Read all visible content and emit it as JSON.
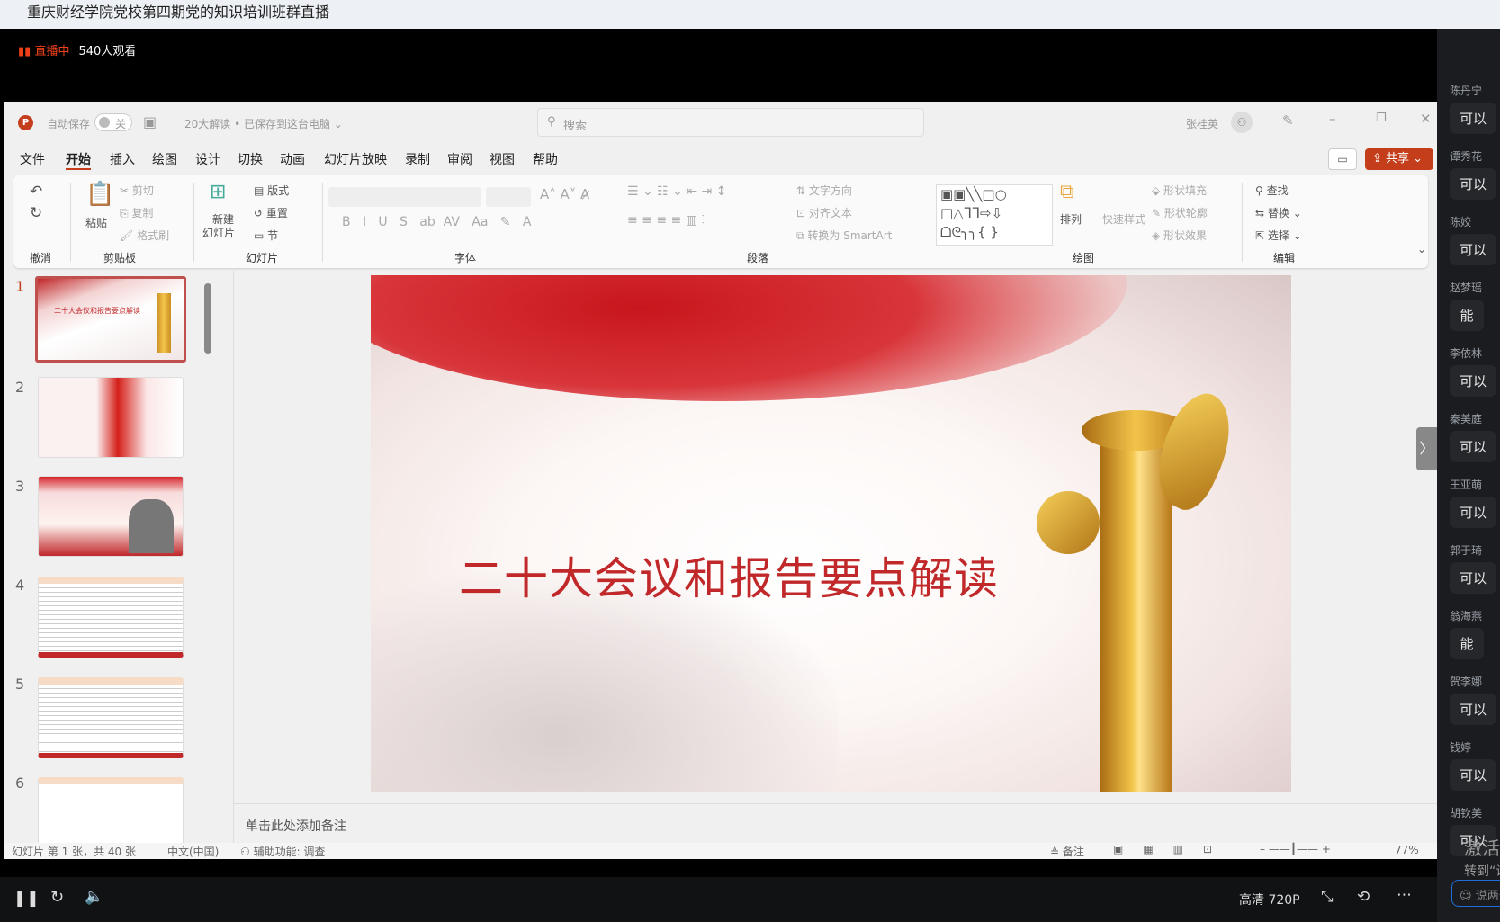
{
  "stream": {
    "title": "重庆财经学院党校第四期党的知识培训班群直播",
    "live_label": "直播中",
    "viewers": "540人观看",
    "quality": "高清 720P"
  },
  "ppt": {
    "autosave_label": "自动保存",
    "autosave_state": "关",
    "doc_title": "20大解读 • 已保存到这台电脑 ⌄",
    "search_placeholder": "搜索",
    "user": "张桂英",
    "menu": [
      "文件",
      "开始",
      "插入",
      "绘图",
      "设计",
      "切换",
      "动画",
      "幻灯片放映",
      "录制",
      "审阅",
      "视图",
      "帮助"
    ],
    "active_menu": "开始",
    "share": "共享",
    "ribbon": {
      "undo_group": "撤消",
      "paste": "粘贴",
      "cut": "剪切",
      "copy": "复制",
      "format_painter": "格式刷",
      "clipboard_group": "剪贴板",
      "new_slide": "新建",
      "new_slide2": "幻灯片",
      "layout": "版式",
      "reset": "重置",
      "section": "节",
      "slides_group": "幻灯片",
      "font_group": "字体",
      "text_direction": "文字方向",
      "align_text": "对齐文本",
      "smartart": "转换为 SmartArt",
      "paragraph_group": "段落",
      "arrange": "排列",
      "quick_styles": "快速样式",
      "shape_fill": "形状填充",
      "shape_outline": "形状轮廓",
      "shape_effects": "形状效果",
      "drawing_group": "绘图",
      "find": "查找",
      "replace": "替换",
      "select": "选择",
      "editing_group": "编辑"
    },
    "slide_numbers": [
      "1",
      "2",
      "3",
      "4",
      "5",
      "6"
    ],
    "slide_title": "二十大会议和报告要点解读",
    "notes_placeholder": "单击此处添加备注",
    "status": {
      "slide_count": "幻灯片 第 1 张，共 40 张",
      "language": "中文(中国)",
      "accessibility": "辅助功能: 调查",
      "notes": "备注",
      "zoom": "77%"
    }
  },
  "comments": [
    {
      "name": "陈丹宁",
      "text": "可以"
    },
    {
      "name": "谭秀花",
      "text": "可以"
    },
    {
      "name": "陈姣",
      "text": "可以"
    },
    {
      "name": "赵梦瑶",
      "text": "能"
    },
    {
      "name": "李依林",
      "text": "可以"
    },
    {
      "name": "秦美庭",
      "text": "可以"
    },
    {
      "name": "王亚萌",
      "text": "可以"
    },
    {
      "name": "郭于琦",
      "text": "可以"
    },
    {
      "name": "翁海燕",
      "text": "能"
    },
    {
      "name": "贺李娜",
      "text": "可以"
    },
    {
      "name": "钱婷",
      "text": "可以"
    },
    {
      "name": "胡钦美",
      "text": "可以"
    }
  ],
  "watermark": [
    "激活",
    "转到“设"
  ],
  "chat_placeholder": "说两句",
  "colors": {
    "accent": "#c43e1c",
    "live": "#f0401a",
    "slide_title": "#c0282a"
  }
}
